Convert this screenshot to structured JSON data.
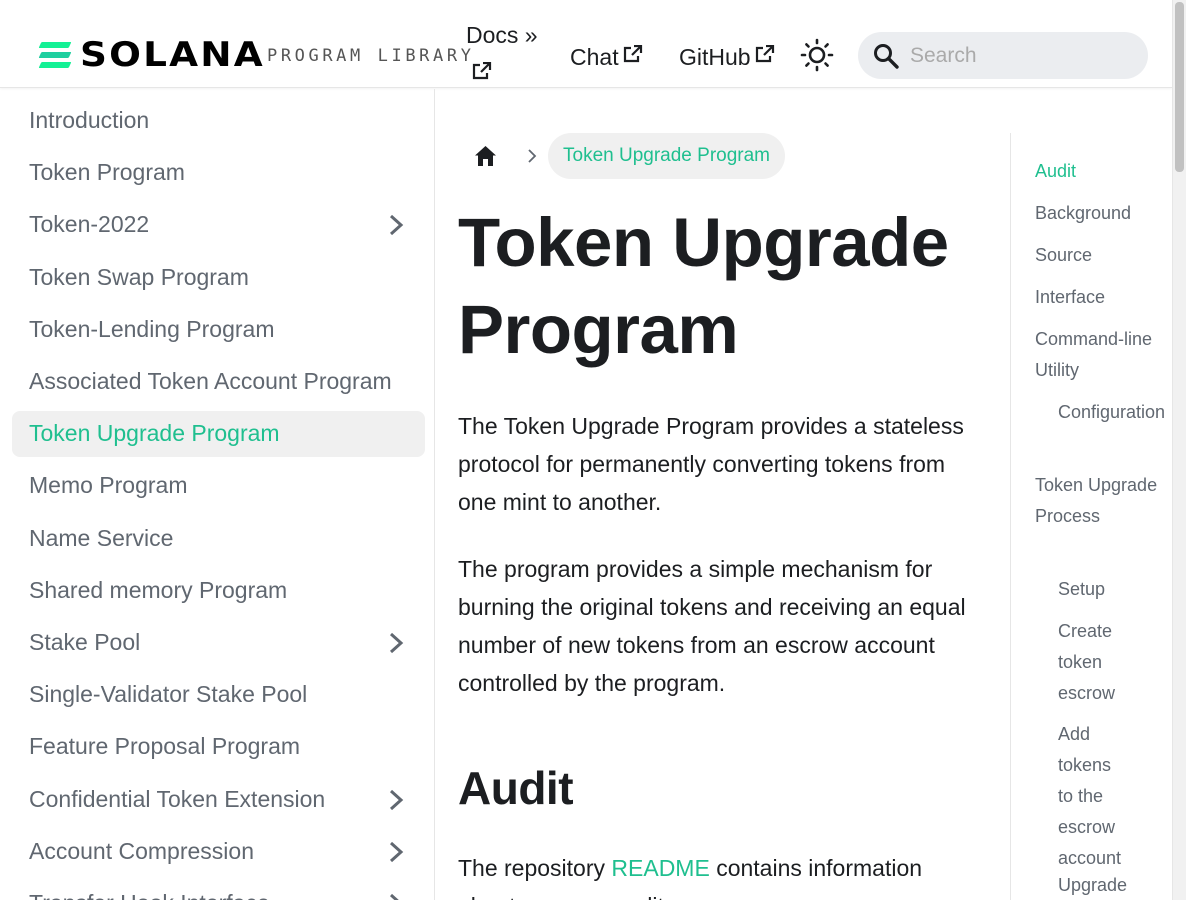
{
  "navbar": {
    "brand_word": "SOLANA",
    "brand_sub": "PROGRAM LIBRARY",
    "docs_label": "Docs »",
    "chat_label": "Chat",
    "github_label": "GitHub",
    "search_placeholder": "Search",
    "theme_icon": "sun-icon",
    "external_icon": "external-link-icon"
  },
  "sidebar": {
    "items": [
      {
        "label": "Introduction",
        "expandable": false
      },
      {
        "label": "Token Program",
        "expandable": false
      },
      {
        "label": "Token-2022",
        "expandable": true
      },
      {
        "label": "Token Swap Program",
        "expandable": false
      },
      {
        "label": "Token-Lending Program",
        "expandable": false
      },
      {
        "label": "Associated Token Account Program",
        "expandable": false
      },
      {
        "label": "Token Upgrade Program",
        "expandable": false,
        "active": true
      },
      {
        "label": "Memo Program",
        "expandable": false
      },
      {
        "label": "Name Service",
        "expandable": false
      },
      {
        "label": "Shared memory Program",
        "expandable": false
      },
      {
        "label": "Stake Pool",
        "expandable": true
      },
      {
        "label": "Single-Validator Stake Pool",
        "expandable": false
      },
      {
        "label": "Feature Proposal Program",
        "expandable": false
      },
      {
        "label": "Confidential Token Extension",
        "expandable": true
      },
      {
        "label": "Account Compression",
        "expandable": true
      },
      {
        "label": "Transfer Hook Interface",
        "expandable": true
      }
    ]
  },
  "main": {
    "breadcrumb_current": "Token Upgrade Program",
    "title": "Token Upgrade Program",
    "intro_1": "The Token Upgrade Program provides a stateless protocol for permanently converting tokens from one mint to another.",
    "intro_2": "The program provides a simple mechanism for burning the original tokens and receiving an equal number of new tokens from an escrow account controlled by the program.",
    "audit_heading": "Audit",
    "audit_text_before": "The repository ",
    "audit_link": "README",
    "audit_text_after": " contains information about program audits."
  },
  "toc": {
    "items": [
      {
        "label": "Audit",
        "level": 1,
        "active": true
      },
      {
        "label": "Background",
        "level": 1
      },
      {
        "label": "Source",
        "level": 1
      },
      {
        "label": "Interface",
        "level": 1
      },
      {
        "label": "Command-line Utility",
        "level": 1
      },
      {
        "label": "Configuration",
        "level": 2
      },
      {
        "label": "Token Upgrade Process",
        "level": 1
      },
      {
        "label": "Setup",
        "level": 2
      },
      {
        "label": "Create token escrow",
        "level": 2
      },
      {
        "label": "Add tokens to the escrow account",
        "level": 2
      },
      {
        "label": "Upgrade tokens",
        "level": 2
      }
    ]
  },
  "colors": {
    "accent": "#1fbf8f",
    "brand_green": "#14f195",
    "text": "#1c1e21",
    "muted": "#606770",
    "active_bg": "#f0f0f0"
  }
}
